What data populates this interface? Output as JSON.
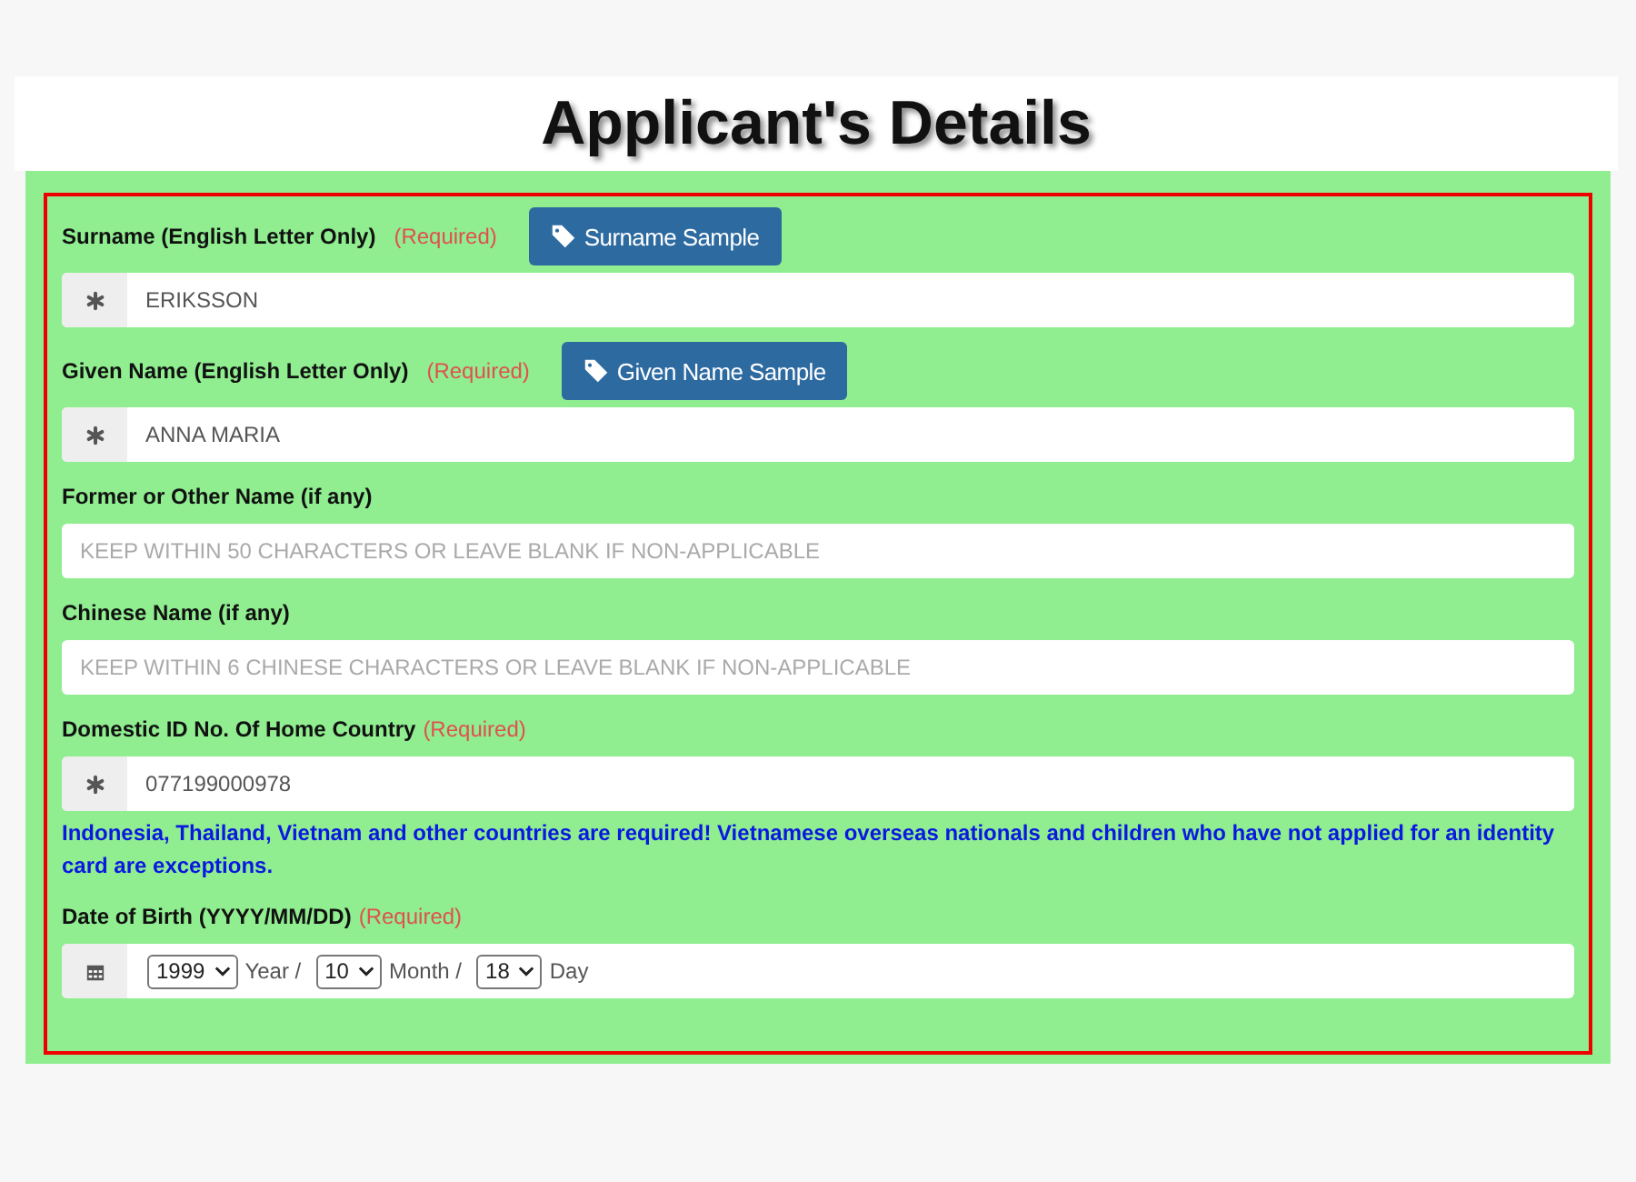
{
  "title": "Applicant's Details",
  "fields": [
    {
      "kind": "text",
      "label": "Surname (English Letter Only)",
      "required": "(Required)",
      "button": "Surname Sample",
      "value": "ERIKSSON"
    },
    {
      "kind": "text",
      "label": "Given Name (English Letter Only)",
      "required": "(Required)",
      "button": "Given Name Sample",
      "value": "ANNA MARIA"
    },
    {
      "kind": "plain",
      "label": "Former or Other Name (if any)",
      "placeholder": "KEEP WITHIN 50 CHARACTERS OR LEAVE BLANK IF NON-APPLICABLE"
    },
    {
      "kind": "plain",
      "label": "Chinese Name (if any)",
      "placeholder": "KEEP WITHIN 6 CHINESE CHARACTERS OR LEAVE BLANK IF NON-APPLICABLE"
    },
    {
      "kind": "text",
      "label": "Domestic ID No. Of Home Country",
      "required": "(Required)",
      "value": "077199000978",
      "note": "Indonesia, Thailand, Vietnam and other countries are required! Vietnamese overseas nationals and children who have not applied for an identity card are exceptions."
    },
    {
      "kind": "date",
      "label": "Date of Birth (YYYY/MM/DD)",
      "required": "(Required)",
      "parts": [
        {
          "value": "1999",
          "unit": "Year /"
        },
        {
          "value": "10",
          "unit": "Month /"
        },
        {
          "value": "18",
          "unit": "Day"
        }
      ]
    }
  ]
}
